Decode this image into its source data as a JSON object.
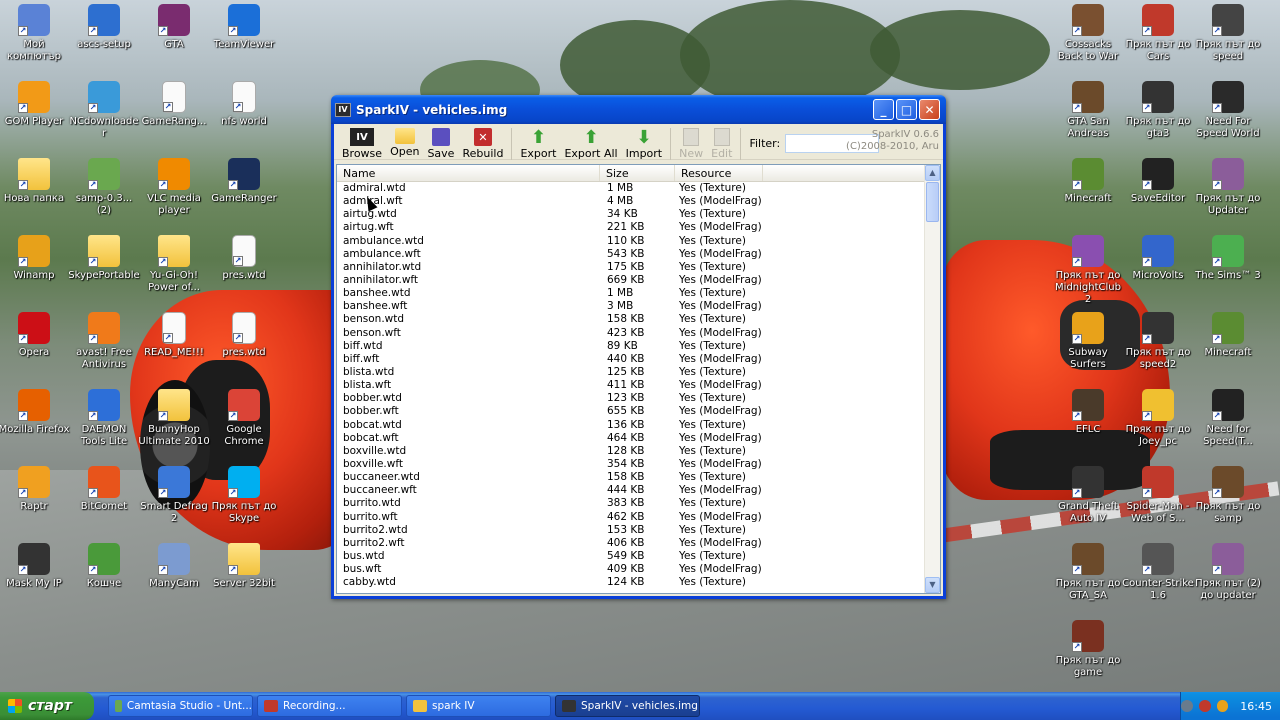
{
  "desktop": {
    "left_icons": [
      {
        "label": "Мой компютър",
        "icon": "my-computer-icon",
        "color": "#5a82d6"
      },
      {
        "label": "ascs-setup",
        "icon": "setup-icon",
        "color": "#2d6fd0"
      },
      {
        "label": "GTA",
        "icon": "archive-icon",
        "color": "#7a2c6f"
      },
      {
        "label": "TeamViewer",
        "icon": "teamviewer-icon",
        "color": "#1b6fd8"
      },
      {
        "label": "GOM Player",
        "icon": "gom-player-icon",
        "color": "#f29a17"
      },
      {
        "label": "NCdownloader",
        "icon": "downloader-icon",
        "color": "#3a9ad9"
      },
      {
        "label": "GameRang...",
        "icon": "document-icon",
        "color": "#ffffff"
      },
      {
        "label": "nfs world",
        "icon": "document-icon",
        "color": "#ffffff"
      },
      {
        "label": "Нова папка",
        "icon": "folder-icon",
        "color": "#f2c23c"
      },
      {
        "label": "samp-0.3... (2)",
        "icon": "globe-icon",
        "color": "#6aa84f"
      },
      {
        "label": "VLC media player",
        "icon": "vlc-icon",
        "color": "#f08a00"
      },
      {
        "label": "GameRanger",
        "icon": "gameranger-icon",
        "color": "#1a2f5a"
      },
      {
        "label": "Winamp",
        "icon": "winamp-icon",
        "color": "#e7a11a"
      },
      {
        "label": "SkypePortable",
        "icon": "folder-icon",
        "color": "#f2c23c"
      },
      {
        "label": "Yu-Gi-Oh! Power of...",
        "icon": "folder-icon",
        "color": "#f2c23c"
      },
      {
        "label": "pres.wtd",
        "icon": "file-icon",
        "color": "#ffffff"
      },
      {
        "label": "Opera",
        "icon": "opera-icon",
        "color": "#cc0f16"
      },
      {
        "label": "avast! Free Antivirus",
        "icon": "avast-icon",
        "color": "#f07a1a"
      },
      {
        "label": "READ_ME!!!",
        "icon": "document-icon",
        "color": "#ffffff"
      },
      {
        "label": "pres.wtd",
        "icon": "file-icon",
        "color": "#ffffff"
      },
      {
        "label": "Mozilla Firefox",
        "icon": "firefox-icon",
        "color": "#e66000"
      },
      {
        "label": "DAEMON Tools Lite",
        "icon": "daemon-tools-icon",
        "color": "#2d6fd8"
      },
      {
        "label": "BunnyHop Ultimate 2010",
        "icon": "folder-icon",
        "color": "#f2c23c"
      },
      {
        "label": "Google Chrome",
        "icon": "chrome-icon",
        "color": "#db4437"
      },
      {
        "label": "Raptr",
        "icon": "raptr-icon",
        "color": "#f0a020"
      },
      {
        "label": "BitComet",
        "icon": "bitcomet-icon",
        "color": "#e8541b"
      },
      {
        "label": "Smart Defrag 2",
        "icon": "defrag-icon",
        "color": "#3b78d8"
      },
      {
        "label": "Пряк път до Skype",
        "icon": "skype-icon",
        "color": "#00aff0"
      },
      {
        "label": "Mask My IP",
        "icon": "spy-icon",
        "color": "#333333"
      },
      {
        "label": "Кошче",
        "icon": "recycle-bin-icon",
        "color": "#4a9a3a"
      },
      {
        "label": "ManyCam",
        "icon": "manycam-icon",
        "color": "#7c9bd0"
      },
      {
        "label": "Server 32bit",
        "icon": "folder-icon",
        "color": "#f2c23c"
      }
    ],
    "right_icons": [
      {
        "label": "Cossacks Back to War",
        "icon": "cossacks-icon",
        "color": "#7a5030"
      },
      {
        "label": "Пряк път до Cars",
        "icon": "cars-icon",
        "color": "#c0392b"
      },
      {
        "label": "Пряк път до speed",
        "icon": "nfs-mw-icon",
        "color": "#444444"
      },
      {
        "label": "GTA San Andreas",
        "icon": "gta-sa-icon",
        "color": "#6b4a2a"
      },
      {
        "label": "Пряк път до gta3",
        "icon": "gta3-icon",
        "color": "#333333"
      },
      {
        "label": "Need For Speed World",
        "icon": "nfs-world-icon",
        "color": "#2a2a2a"
      },
      {
        "label": "Minecraft",
        "icon": "minecraft-icon",
        "color": "#5b8c32"
      },
      {
        "label": "SaveEditor",
        "icon": "mw-icon",
        "color": "#222222"
      },
      {
        "label": "Пряк път до Updater",
        "icon": "updater-icon",
        "color": "#8b5d9a"
      },
      {
        "label": "Пряк път до MidnightClub2",
        "icon": "midnight-club-icon",
        "color": "#8a4fb0"
      },
      {
        "label": "MicroVolts",
        "icon": "microvolts-icon",
        "color": "#3366cc"
      },
      {
        "label": "The Sims™ 3",
        "icon": "sims3-icon",
        "color": "#4caf50"
      },
      {
        "label": "Subway Surfers",
        "icon": "subway-surfers-icon",
        "color": "#e8a21a"
      },
      {
        "label": "Пряк път до speed2",
        "icon": "nfs-icon",
        "color": "#333333"
      },
      {
        "label": "Minecraft",
        "icon": "minecraft-icon",
        "color": "#5b8c32"
      },
      {
        "label": "EFLC",
        "icon": "eflc-icon",
        "color": "#4a3a2a"
      },
      {
        "label": "Пряк път до Joey_pc",
        "icon": "joey-icon",
        "color": "#f0c030"
      },
      {
        "label": "Need for Speed(T...",
        "icon": "nfs-t-icon",
        "color": "#222222"
      },
      {
        "label": "Grand Theft Auto IV",
        "icon": "gta4-icon",
        "color": "#333333"
      },
      {
        "label": "Spider-Man - Web of S...",
        "icon": "spiderman-icon",
        "color": "#c0392b"
      },
      {
        "label": "Пряк път до samp",
        "icon": "samp-icon",
        "color": "#6b4a2a"
      },
      {
        "label": "Пряк път до GTA_SA",
        "icon": "gta-sa-icon",
        "color": "#6b4a2a"
      },
      {
        "label": "Counter-Strike 1.6",
        "icon": "counter-strike-icon",
        "color": "#555555"
      },
      {
        "label": "Пряк път (2) до updater",
        "icon": "updater-icon",
        "color": "#8b5d9a"
      },
      {
        "label": "Пряк път до game",
        "icon": "game-icon",
        "color": "#7a3020"
      }
    ]
  },
  "window": {
    "title": "SparkIV - vehicles.img",
    "app_icon_text": "IV",
    "toolbar": {
      "browse": "Browse",
      "open": "Open",
      "save": "Save",
      "rebuild": "Rebuild",
      "export": "Export",
      "export_all": "Export All",
      "import": "Import",
      "new": "New",
      "edit": "Edit",
      "filter_label": "Filter:",
      "filter_value": "",
      "about_line1": "SparkIV 0.6.6",
      "about_line2": "(C)2008-2010, Aru"
    },
    "columns": {
      "name": "Name",
      "size": "Size",
      "resource": "Resource"
    },
    "rows": [
      [
        "admiral.wtd",
        "1 MB",
        "Yes (Texture)"
      ],
      [
        "admiral.wft",
        "4 MB",
        "Yes (ModelFrag)"
      ],
      [
        "airtug.wtd",
        "34 KB",
        "Yes (Texture)"
      ],
      [
        "airtug.wft",
        "221 KB",
        "Yes (ModelFrag)"
      ],
      [
        "ambulance.wtd",
        "110 KB",
        "Yes (Texture)"
      ],
      [
        "ambulance.wft",
        "543 KB",
        "Yes (ModelFrag)"
      ],
      [
        "annihilator.wtd",
        "175 KB",
        "Yes (Texture)"
      ],
      [
        "annihilator.wft",
        "669 KB",
        "Yes (ModelFrag)"
      ],
      [
        "banshee.wtd",
        "1 MB",
        "Yes (Texture)"
      ],
      [
        "banshee.wft",
        "3 MB",
        "Yes (ModelFrag)"
      ],
      [
        "benson.wtd",
        "158 KB",
        "Yes (Texture)"
      ],
      [
        "benson.wft",
        "423 KB",
        "Yes (ModelFrag)"
      ],
      [
        "biff.wtd",
        "89 KB",
        "Yes (Texture)"
      ],
      [
        "biff.wft",
        "440 KB",
        "Yes (ModelFrag)"
      ],
      [
        "blista.wtd",
        "125 KB",
        "Yes (Texture)"
      ],
      [
        "blista.wft",
        "411 KB",
        "Yes (ModelFrag)"
      ],
      [
        "bobber.wtd",
        "123 KB",
        "Yes (Texture)"
      ],
      [
        "bobber.wft",
        "655 KB",
        "Yes (ModelFrag)"
      ],
      [
        "bobcat.wtd",
        "136 KB",
        "Yes (Texture)"
      ],
      [
        "bobcat.wft",
        "464 KB",
        "Yes (ModelFrag)"
      ],
      [
        "boxville.wtd",
        "128 KB",
        "Yes (Texture)"
      ],
      [
        "boxville.wft",
        "354 KB",
        "Yes (ModelFrag)"
      ],
      [
        "buccaneer.wtd",
        "158 KB",
        "Yes (Texture)"
      ],
      [
        "buccaneer.wft",
        "444 KB",
        "Yes (ModelFrag)"
      ],
      [
        "burrito.wtd",
        "383 KB",
        "Yes (Texture)"
      ],
      [
        "burrito.wft",
        "462 KB",
        "Yes (ModelFrag)"
      ],
      [
        "burrito2.wtd",
        "153 KB",
        "Yes (Texture)"
      ],
      [
        "burrito2.wft",
        "406 KB",
        "Yes (ModelFrag)"
      ],
      [
        "bus.wtd",
        "549 KB",
        "Yes (Texture)"
      ],
      [
        "bus.wft",
        "409 KB",
        "Yes (ModelFrag)"
      ],
      [
        "cabby.wtd",
        "124 KB",
        "Yes (Texture)"
      ]
    ]
  },
  "taskbar": {
    "start_label": "старт",
    "tasks": [
      {
        "label": "Camtasia Studio - Unt...",
        "icon": "camtasia-icon",
        "color": "#6aa84f"
      },
      {
        "label": "Recording...",
        "icon": "recording-icon",
        "color": "#c0392b"
      },
      {
        "label": "spark IV",
        "icon": "folder-icon",
        "color": "#f2c23c"
      },
      {
        "label": "SparkIV - vehicles.img",
        "icon": "sparkiv-icon",
        "color": "#333333"
      }
    ],
    "clock": "16:45"
  }
}
